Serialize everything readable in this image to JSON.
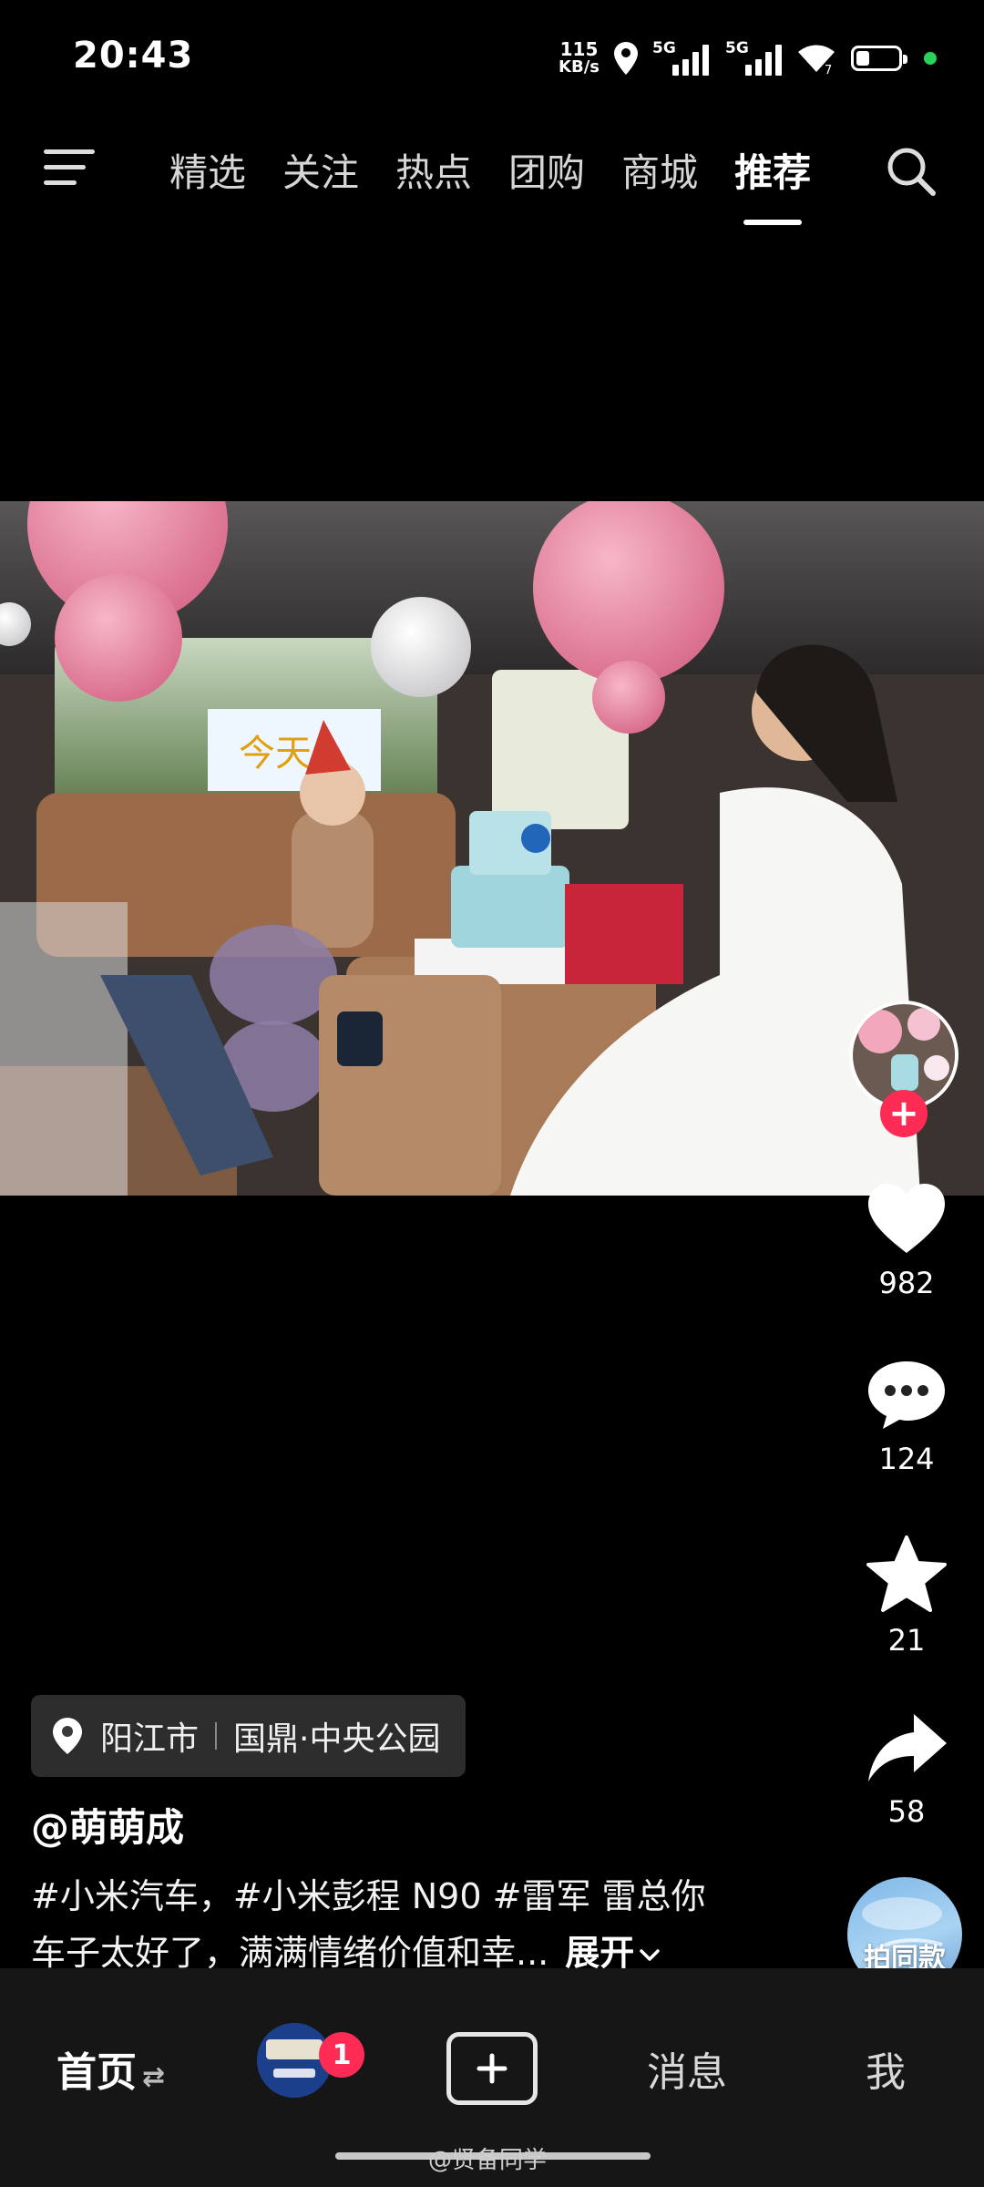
{
  "status_bar": {
    "time": "20:43",
    "net_speed_value": "115",
    "net_speed_unit": "KB/s",
    "sim1_label": "5G",
    "sim2_label": "5G",
    "wifi_badge": "7"
  },
  "top_nav": {
    "tabs": [
      "精选",
      "关注",
      "热点",
      "团购",
      "商城",
      "推荐"
    ],
    "active_tab": "推荐"
  },
  "actions": {
    "likes": "982",
    "comments": "124",
    "favorites": "21",
    "shares": "58",
    "same_style_label": "拍同款"
  },
  "location": {
    "city": "阳江市",
    "place": "国鼎·中央公园"
  },
  "author": "@萌萌成",
  "caption": {
    "line1": "#小米汽车，#小米彭程 N90 #雷军 雷总你",
    "line2": "车子太好了，满满情绪价值和幸...",
    "expand": "展开"
  },
  "bottom_nav": {
    "home": "首页",
    "home_switch": "⇄",
    "badge_count": "1",
    "messages": "消息",
    "me": "我"
  },
  "watermark": "@贤备同学",
  "icons": [
    "menu-icon",
    "search-icon",
    "location-pin-icon",
    "heart-icon",
    "comment-icon",
    "star-icon",
    "share-icon",
    "plus-icon"
  ]
}
